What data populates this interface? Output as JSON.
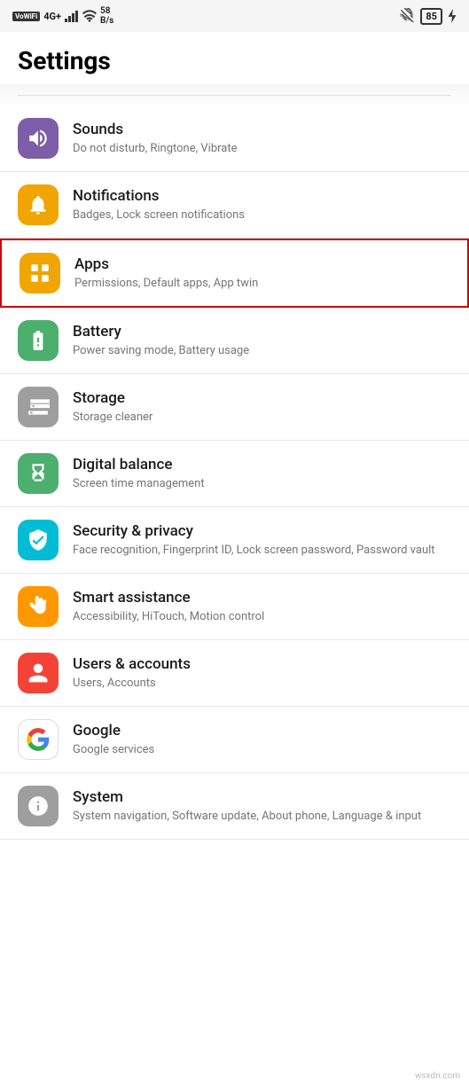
{
  "statusBar": {
    "left": {
      "wifi": "VoWiFi",
      "network": "4G+",
      "signal": "signal",
      "wifiSignal": "wifi",
      "speed": "58 B/s"
    },
    "right": {
      "mute": "mute",
      "battery": "85"
    }
  },
  "header": {
    "title": "Settings"
  },
  "items": [
    {
      "id": "sounds",
      "iconClass": "icon-sounds",
      "iconName": "speaker-icon",
      "title": "Sounds",
      "subtitle": "Do not disturb, Ringtone, Vibrate",
      "highlighted": false
    },
    {
      "id": "notifications",
      "iconClass": "icon-notifications",
      "iconName": "bell-icon",
      "title": "Notifications",
      "subtitle": "Badges, Lock screen notifications",
      "highlighted": false
    },
    {
      "id": "apps",
      "iconClass": "icon-apps",
      "iconName": "apps-icon",
      "title": "Apps",
      "subtitle": "Permissions, Default apps, App twin",
      "highlighted": true
    },
    {
      "id": "battery",
      "iconClass": "icon-battery",
      "iconName": "battery-icon",
      "title": "Battery",
      "subtitle": "Power saving mode, Battery usage",
      "highlighted": false
    },
    {
      "id": "storage",
      "iconClass": "icon-storage",
      "iconName": "storage-icon",
      "title": "Storage",
      "subtitle": "Storage cleaner",
      "highlighted": false
    },
    {
      "id": "digital",
      "iconClass": "icon-digital",
      "iconName": "hourglass-icon",
      "title": "Digital balance",
      "subtitle": "Screen time management",
      "highlighted": false
    },
    {
      "id": "security",
      "iconClass": "icon-security",
      "iconName": "shield-icon",
      "title": "Security & privacy",
      "subtitle": "Face recognition, Fingerprint ID, Lock screen password, Password vault",
      "highlighted": false
    },
    {
      "id": "smart",
      "iconClass": "icon-smart",
      "iconName": "hand-icon",
      "title": "Smart assistance",
      "subtitle": "Accessibility, HiTouch, Motion control",
      "highlighted": false
    },
    {
      "id": "users",
      "iconClass": "icon-users",
      "iconName": "user-icon",
      "title": "Users & accounts",
      "subtitle": "Users, Accounts",
      "highlighted": false
    },
    {
      "id": "google",
      "iconClass": "icon-google",
      "iconName": "google-icon",
      "title": "Google",
      "subtitle": "Google services",
      "highlighted": false
    },
    {
      "id": "system",
      "iconClass": "icon-system",
      "iconName": "info-icon",
      "title": "System",
      "subtitle": "System navigation, Software update, About phone, Language & input",
      "highlighted": false
    }
  ]
}
